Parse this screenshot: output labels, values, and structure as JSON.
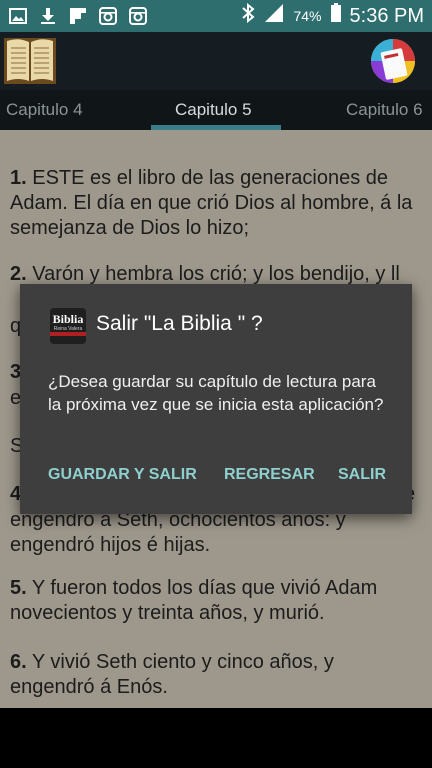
{
  "status_bar": {
    "battery_percent": "74%",
    "time": "5:36 PM",
    "left_icons": [
      "gallery-icon",
      "download-icon",
      "flipboard-icon",
      "instagram-icon",
      "instagram-icon"
    ],
    "right_icons": [
      "bluetooth-icon",
      "signal-icon",
      "battery-icon"
    ]
  },
  "action_bar": {
    "icons": [
      "bible-book-icon",
      "app-logo-icon"
    ]
  },
  "tabs": [
    {
      "label": "Capitulo 4",
      "active": false
    },
    {
      "label": "Capitulo 5",
      "active": true
    },
    {
      "label": "Capitulo 6",
      "active": false
    }
  ],
  "verses": [
    {
      "num": "1.",
      "text": " ESTE es el libro de las generaciones de Adam. El día en que crió Dios al hombre, á la semejanza de Dios lo hizo;"
    },
    {
      "num": "2.",
      "text": " Varón y hembra los crió; y los bendijo, y ll"
    },
    {
      "num": "3.",
      "text": ""
    },
    {
      "num": "4.",
      "text": ""
    },
    {
      "num": "5.",
      "text": " Y fueron todos los días que vivió Adam novecientos y treinta años, y murió."
    },
    {
      "num": "6.",
      "text": " Y vivió Seth ciento y cinco años, y engendró á Enós."
    }
  ],
  "verse_fragments": {
    "line_q": "q",
    "line_e": "e",
    "line_s": "S",
    "verse4_end": "e",
    "verse4_line2": "engendró á Seth, ochocientos años: y",
    "verse4_line3": "engendró hijos é hijas."
  },
  "dialog": {
    "icon_text_top": "Biblia",
    "icon_text_bottom": "Reina Valera",
    "title": "Salir \"La Biblia \" ?",
    "message": "¿Desea guardar su capítulo de lectura para la próxima vez que se inicia esta aplicación?",
    "buttons": {
      "save_exit": "GUARDAR Y SALIR",
      "back": "REGRESAR",
      "exit": "SALIR"
    }
  },
  "colors": {
    "status_bar": "#2e6e6e",
    "action_bar": "#161d22",
    "content_bg": "#9e988c",
    "dialog_bg": "#3e3e3e",
    "accent_button": "#8fd0cf",
    "tab_indicator": "#3a7c8c"
  }
}
